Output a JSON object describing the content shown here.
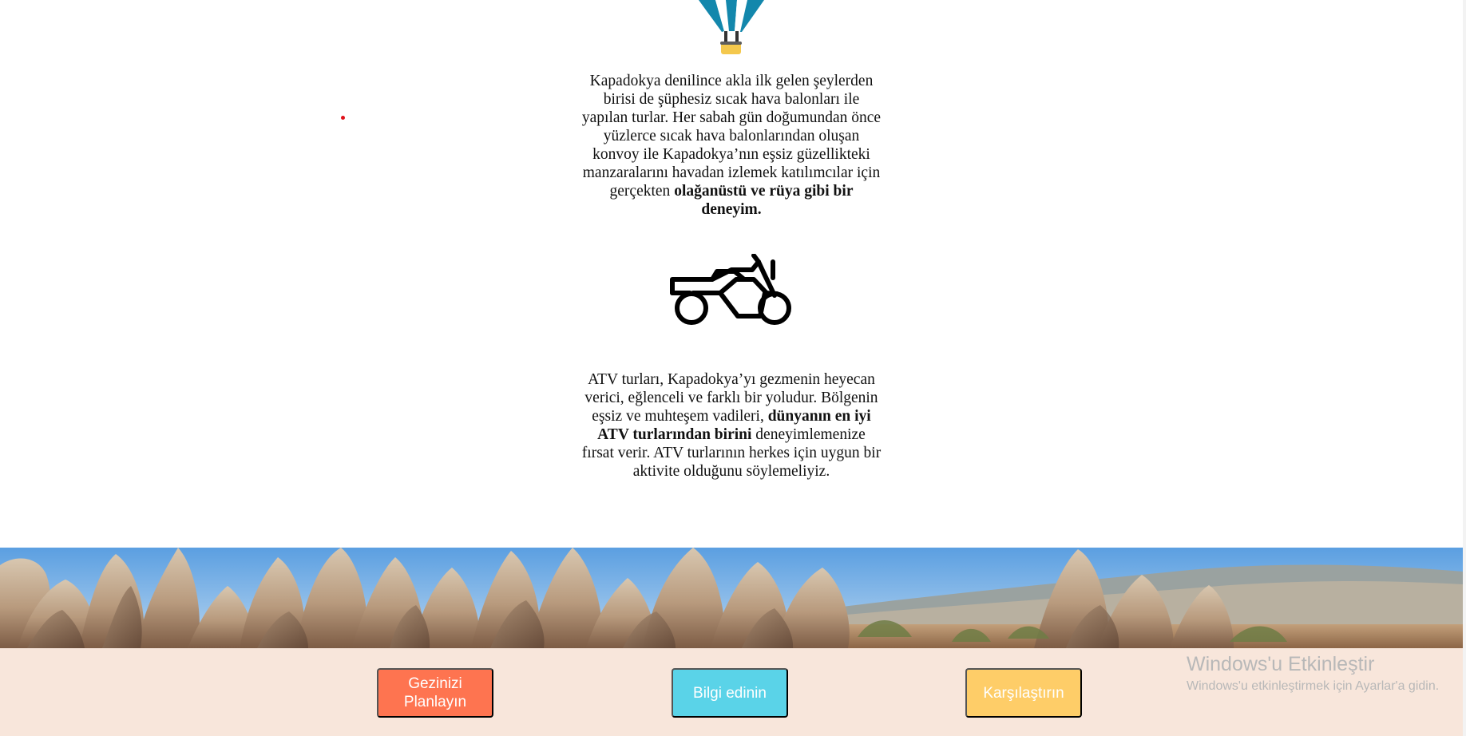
{
  "sections": {
    "balloon": {
      "icon": "hot-air-balloon-icon",
      "text_before_bold": "Kapadokya denilince akla ilk gelen şeylerden birisi de şüphesiz sıcak hava balonları ile yapılan turlar. Her sabah gün doğumundan önce yüzlerce sıcak hava balonlarından oluşan konvoy ile Kapadokya’nın eşsiz güzellikteki manzaralarını havadan izlemek katılımcılar için gerçekten ",
      "bold_text": "olağanüstü ve rüya gibi bir deneyim.",
      "text_after_bold": ""
    },
    "atv": {
      "icon": "atv-motorcycle-icon",
      "text_before_bold": "ATV turları, Kapadokya’yı gezmenin heyecan verici, eğlenceli ve farklı bir yoludur. Bölgenin eşsiz ve muhteşem vadileri, ",
      "bold_text": "dünyanın en iyi ATV turlarından birini",
      "text_after_bold": " deneyimlemenize fırsat verir. ATV turlarının herkes için uygun bir aktivite olduğunu söylemeliyiz."
    }
  },
  "actions": {
    "plan": "Gezinizi Planlayın",
    "info": "Bilgi edinin",
    "compare": "Karşılaştırın"
  },
  "watermark": {
    "title": "Windows'u Etkinleştir",
    "subtitle": "Windows'u etkinleştirmek için Ayarlar'a gidin."
  },
  "colors": {
    "plan": "#fe7450",
    "info": "#5ad3e8",
    "compare": "#fecd68",
    "action_bar_background": "#f8e6db",
    "balloon_blue": "#1387ac",
    "balloon_basket": "#f4c84d"
  }
}
